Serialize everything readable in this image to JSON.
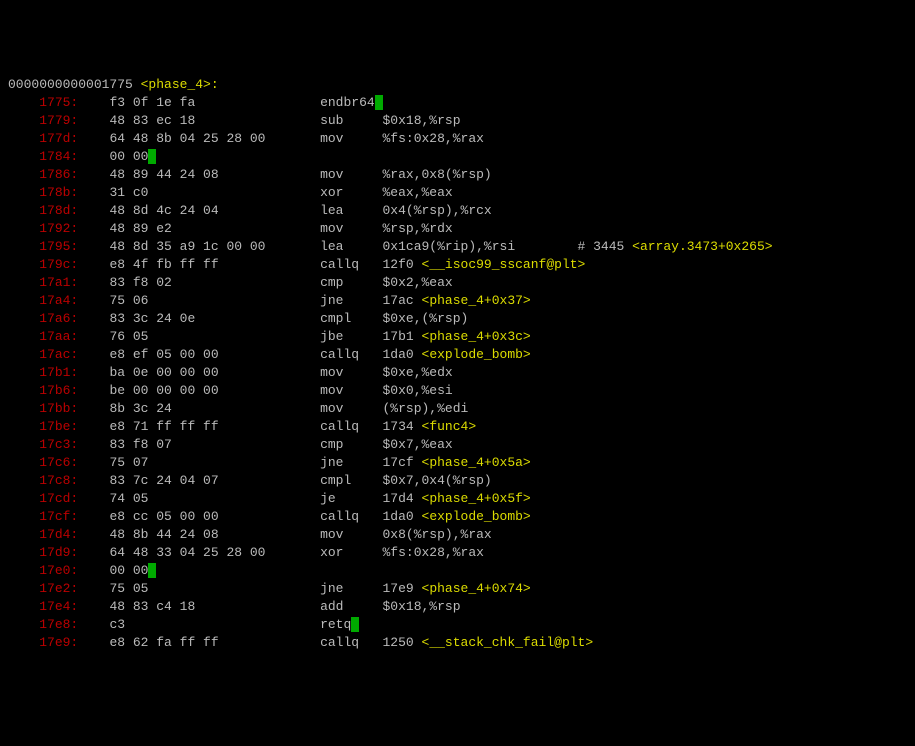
{
  "header": {
    "addressPrefix": "0000000000001775",
    "label": "<phase_4>:"
  },
  "lines": [
    {
      "addr": "1775:",
      "hex": "f3 0f 1e fa",
      "mn": "endbr64",
      "mnHL": true,
      "op": "",
      "sym": ""
    },
    {
      "addr": "1779:",
      "hex": "48 83 ec 18",
      "mn": "sub",
      "op": "$0x18,%rsp",
      "sym": ""
    },
    {
      "addr": "177d:",
      "hex": "64 48 8b 04 25 28 00",
      "mn": "mov",
      "op": "%fs:0x28,%rax",
      "sym": ""
    },
    {
      "addr": "1784:",
      "hex": "00 00",
      "hexHL": true,
      "mn": "",
      "op": "",
      "sym": ""
    },
    {
      "addr": "1786:",
      "hex": "48 89 44 24 08",
      "mn": "mov",
      "op": "%rax,0x8(%rsp)",
      "sym": ""
    },
    {
      "addr": "178b:",
      "hex": "31 c0",
      "mn": "xor",
      "op": "%eax,%eax",
      "sym": ""
    },
    {
      "addr": "178d:",
      "hex": "48 8d 4c 24 04",
      "mn": "lea",
      "op": "0x4(%rsp),%rcx",
      "sym": ""
    },
    {
      "addr": "1792:",
      "hex": "48 89 e2",
      "mn": "mov",
      "op": "%rsp,%rdx",
      "sym": ""
    },
    {
      "addr": "1795:",
      "hex": "48 8d 35 a9 1c 00 00",
      "mn": "lea",
      "op": "0x1ca9(%rip),%rsi        # 3445 ",
      "sym": "<array.3473+0x265>"
    },
    {
      "addr": "179c:",
      "hex": "e8 4f fb ff ff",
      "mn": "callq",
      "op": "12f0 ",
      "sym": "<__isoc99_sscanf@plt>"
    },
    {
      "addr": "17a1:",
      "hex": "83 f8 02",
      "mn": "cmp",
      "op": "$0x2,%eax",
      "sym": ""
    },
    {
      "addr": "17a4:",
      "hex": "75 06",
      "mn": "jne",
      "op": "17ac ",
      "sym": "<phase_4+0x37>"
    },
    {
      "addr": "17a6:",
      "hex": "83 3c 24 0e",
      "mn": "cmpl",
      "op": "$0xe,(%rsp)",
      "sym": ""
    },
    {
      "addr": "17aa:",
      "hex": "76 05",
      "mn": "jbe",
      "op": "17b1 ",
      "sym": "<phase_4+0x3c>"
    },
    {
      "addr": "17ac:",
      "hex": "e8 ef 05 00 00",
      "mn": "callq",
      "op": "1da0 ",
      "sym": "<explode_bomb>"
    },
    {
      "addr": "17b1:",
      "hex": "ba 0e 00 00 00",
      "mn": "mov",
      "op": "$0xe,%edx",
      "sym": ""
    },
    {
      "addr": "17b6:",
      "hex": "be 00 00 00 00",
      "mn": "mov",
      "op": "$0x0,%esi",
      "sym": ""
    },
    {
      "addr": "17bb:",
      "hex": "8b 3c 24",
      "mn": "mov",
      "op": "(%rsp),%edi",
      "sym": ""
    },
    {
      "addr": "17be:",
      "hex": "e8 71 ff ff ff",
      "mn": "callq",
      "op": "1734 ",
      "sym": "<func4>"
    },
    {
      "addr": "17c3:",
      "hex": "83 f8 07",
      "mn": "cmp",
      "op": "$0x7,%eax",
      "sym": ""
    },
    {
      "addr": "17c6:",
      "hex": "75 07",
      "mn": "jne",
      "op": "17cf ",
      "sym": "<phase_4+0x5a>"
    },
    {
      "addr": "17c8:",
      "hex": "83 7c 24 04 07",
      "mn": "cmpl",
      "op": "$0x7,0x4(%rsp)",
      "sym": ""
    },
    {
      "addr": "17cd:",
      "hex": "74 05",
      "mn": "je",
      "op": "17d4 ",
      "sym": "<phase_4+0x5f>"
    },
    {
      "addr": "17cf:",
      "hex": "e8 cc 05 00 00",
      "mn": "callq",
      "op": "1da0 ",
      "sym": "<explode_bomb>"
    },
    {
      "addr": "17d4:",
      "hex": "48 8b 44 24 08",
      "mn": "mov",
      "op": "0x8(%rsp),%rax",
      "sym": ""
    },
    {
      "addr": "17d9:",
      "hex": "64 48 33 04 25 28 00",
      "mn": "xor",
      "op": "%fs:0x28,%rax",
      "sym": ""
    },
    {
      "addr": "17e0:",
      "hex": "00 00",
      "hexHL": true,
      "mn": "",
      "op": "",
      "sym": ""
    },
    {
      "addr": "17e2:",
      "hex": "75 05",
      "mn": "jne",
      "op": "17e9 ",
      "sym": "<phase_4+0x74>"
    },
    {
      "addr": "17e4:",
      "hex": "48 83 c4 18",
      "mn": "add",
      "op": "$0x18,%rsp",
      "sym": ""
    },
    {
      "addr": "17e8:",
      "hex": "c3",
      "mn": "retq",
      "mnHL": true,
      "op": "",
      "sym": ""
    },
    {
      "addr": "17e9:",
      "hex": "e8 62 fa ff ff",
      "mn": "callq",
      "op": "1250 ",
      "sym": "<__stack_chk_fail@plt>"
    }
  ],
  "layout": {
    "addrWidth": 9,
    "hexWidth": 27,
    "mnWidth": 8
  }
}
